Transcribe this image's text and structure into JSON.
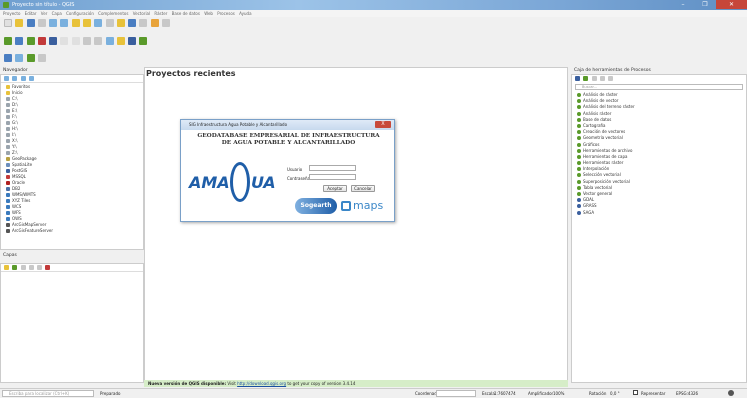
{
  "window": {
    "title": "Proyecto sin título - QGIS",
    "controls": [
      "–",
      "❐",
      "✕"
    ]
  },
  "menubar": [
    "Proyecto",
    "Editar",
    "Ver",
    "Capa",
    "Configuración",
    "Complementos",
    "Vectorial",
    "Ráster",
    "Base de datos",
    "Web",
    "Procesos",
    "Ayuda"
  ],
  "navigator": {
    "title": "Navegador",
    "items": [
      {
        "label": "Favoritos",
        "color": "#e8c23a"
      },
      {
        "label": "Inicio",
        "color": "#e8c23a"
      },
      {
        "label": "C:\\",
        "color": "#9aa4ad"
      },
      {
        "label": "D:\\",
        "color": "#9aa4ad"
      },
      {
        "label": "E:\\",
        "color": "#9aa4ad"
      },
      {
        "label": "F:\\",
        "color": "#9aa4ad"
      },
      {
        "label": "G:\\",
        "color": "#9aa4ad"
      },
      {
        "label": "H:\\",
        "color": "#9aa4ad"
      },
      {
        "label": "I:\\",
        "color": "#9aa4ad"
      },
      {
        "label": "X:\\",
        "color": "#9aa4ad"
      },
      {
        "label": "Y:\\",
        "color": "#9aa4ad"
      },
      {
        "label": "Z:\\",
        "color": "#9aa4ad"
      },
      {
        "label": "GeoPackage",
        "color": "#b8a040"
      },
      {
        "label": "SpatiaLite",
        "color": "#6c8fbd"
      },
      {
        "label": "PostGIS",
        "color": "#3a5f9e"
      },
      {
        "label": "MSSQL",
        "color": "#c23a3a"
      },
      {
        "label": "Oracle",
        "color": "#b02020"
      },
      {
        "label": "DB2",
        "color": "#4a6fa5"
      },
      {
        "label": "WMS/WMTS",
        "color": "#3a7abd"
      },
      {
        "label": "XYZ Tiles",
        "color": "#3a7abd"
      },
      {
        "label": "WCS",
        "color": "#3a7abd"
      },
      {
        "label": "WFS",
        "color": "#3a7abd"
      },
      {
        "label": "OWS",
        "color": "#3a7abd"
      },
      {
        "label": "ArcGisMapServer",
        "color": "#555"
      },
      {
        "label": "ArcGisFeatureServer",
        "color": "#555"
      }
    ]
  },
  "layers": {
    "title": "Capas"
  },
  "main": {
    "recent_title": "Proyectos recientes",
    "news_bold": "Nueva versión de QGIS disponible:",
    "news_pre": " Visit ",
    "news_link": "http://download.qgis.org",
    "news_post": " to get your copy of version 3.4.14"
  },
  "toolbox": {
    "title": "Caja de herramientas de Procesos",
    "search_placeholder": "Buscar...",
    "items": [
      "Análisis de ráster",
      "Análisis de vector",
      "Análisis del terreno ráster",
      "Análisis ráster",
      "Base de datos",
      "Cartografía",
      "Creación de vectores",
      "Geometría vectorial",
      "Gráficos",
      "Herramientas de archivo",
      "Herramientas de capa",
      "Herramientas ráster",
      "Interpolación",
      "Selección vectorial",
      "Superposición vectorial",
      "Tabla vectorial",
      "Vector general",
      "GDAL",
      "GRASS",
      "SAGA"
    ]
  },
  "dialog": {
    "title": "SIG Infraestructura Agua Potable y Alcantarillado",
    "close": "X",
    "heading_line1": "GEODATABASE EMPRESARIAL DE INFRAESTRUCTURA",
    "heading_line2": "DE AGUA POTABLE Y ALCANTARILLADO",
    "logo_left": "AMA",
    "logo_right": "UA",
    "user_label": "Usuario",
    "password_label": "Contraseña",
    "accept": "Aceptar",
    "cancel": "Cancelar",
    "brand1": "Sogearth",
    "brand2": "maps"
  },
  "status": {
    "locator_placeholder": "Escriba para localizar (Ctrl+K)",
    "message": "Preparado",
    "coord_label": "Coordenada",
    "scale_label": "Escala",
    "scale_value": "1:7607474",
    "magnifier_label": "Amplificador",
    "magnifier_value": "100%",
    "rotation_label": "Rotación",
    "rotation_value": "0,0 °",
    "render_label": "Representar",
    "crs": "EPSG:4326"
  }
}
